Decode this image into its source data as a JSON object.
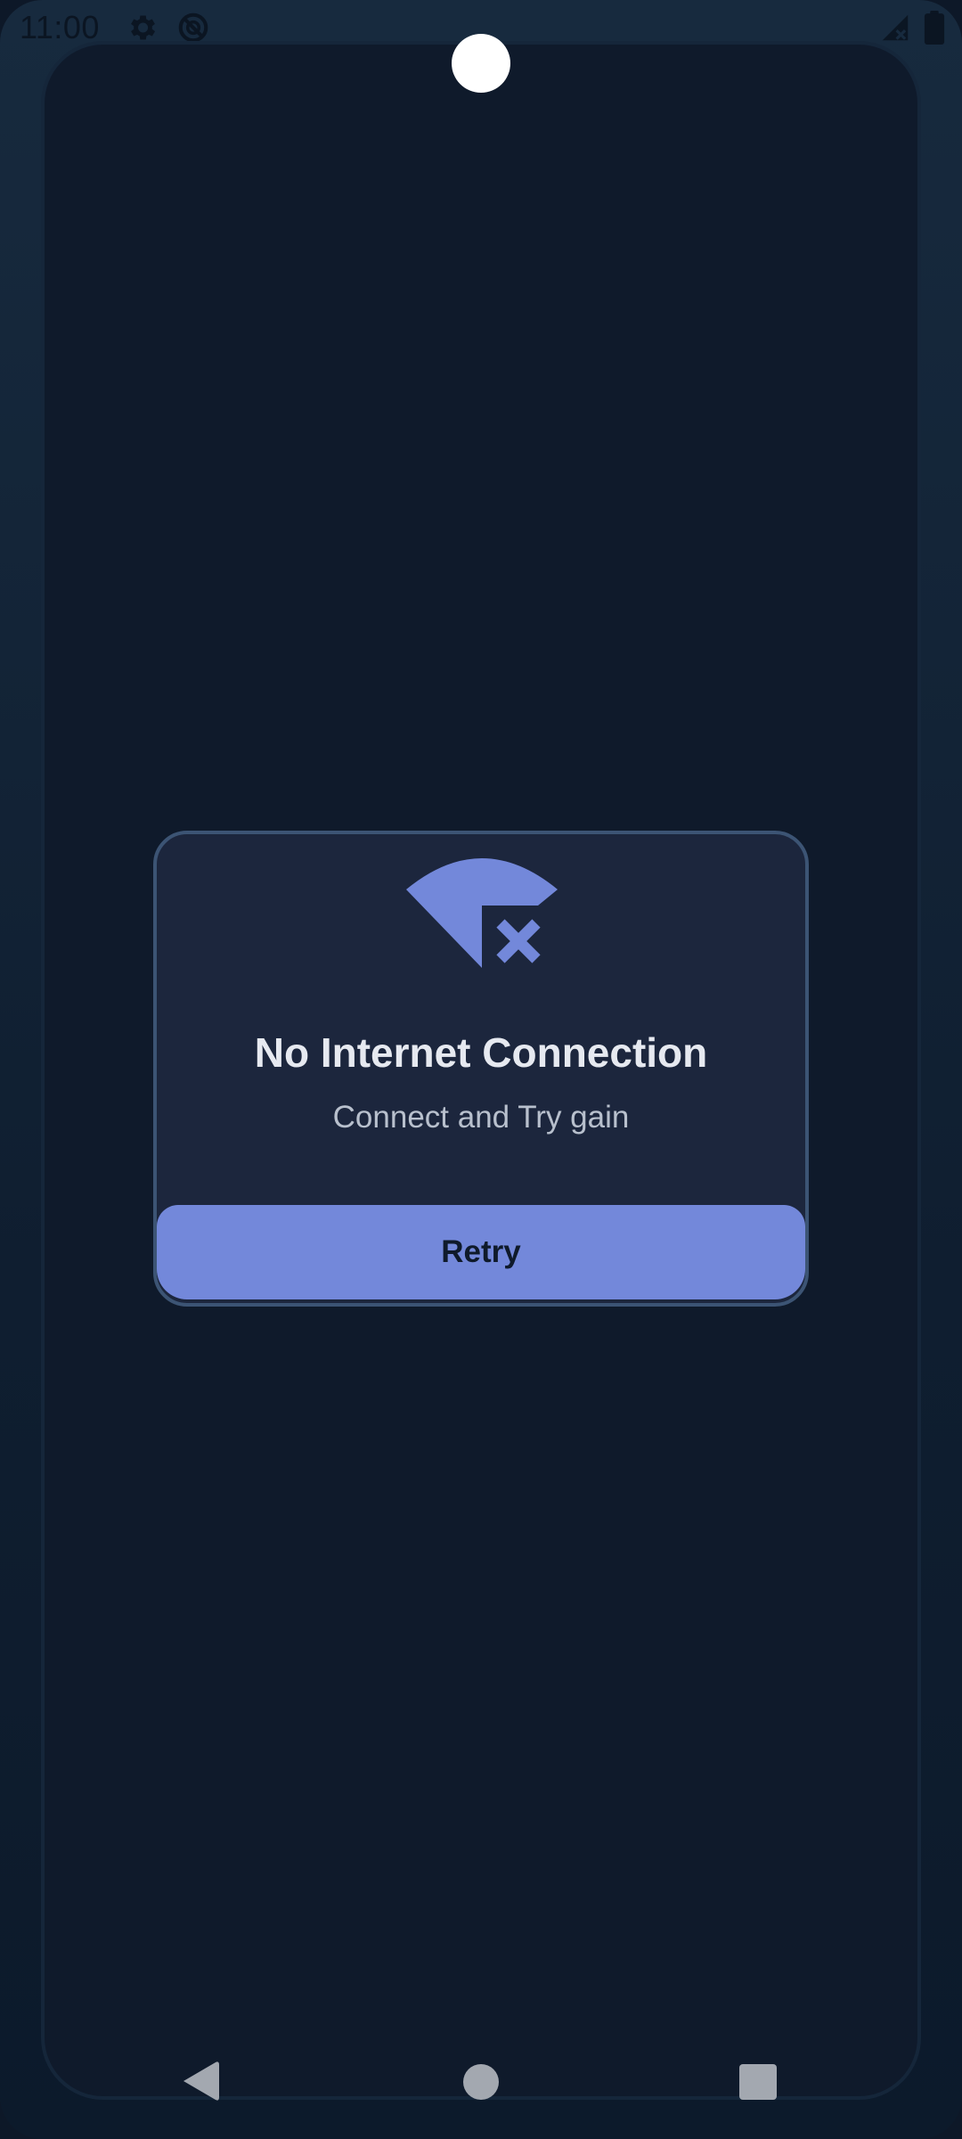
{
  "status_bar": {
    "time": "11:00",
    "icons": [
      "gear-icon",
      "do-not-disturb-icon",
      "no-signal-icon",
      "battery-icon"
    ]
  },
  "dialog": {
    "icon": "wifi-off-icon",
    "title": "No Internet Connection",
    "subtitle": "Connect and Try gain",
    "retry_label": "Retry"
  },
  "nav_bar": {
    "icons": [
      "back-icon",
      "home-icon",
      "recents-icon"
    ]
  },
  "colors": {
    "accent": "#7388da",
    "dialog_bg": "#1c263d",
    "dialog_border": "#3c5474",
    "screen_bg": "#0f1a2b"
  }
}
